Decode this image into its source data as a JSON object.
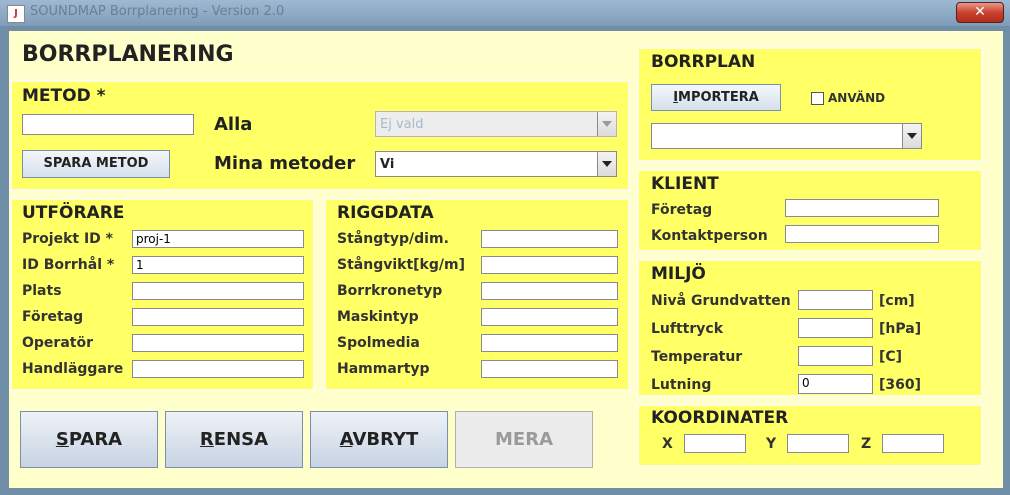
{
  "window": {
    "title": "SOUNDMAP Borrplanering - Version 2.0",
    "close_label": "✕",
    "app_icon_label": "J"
  },
  "header": {
    "title": "BORRPLANERING"
  },
  "metod": {
    "title": "METOD *",
    "input_value": "",
    "alla_label": "Alla",
    "alla_selected": "Ej vald",
    "save_method_label": "SPARA METOD",
    "mina_label": "Mina metoder",
    "mina_selected": "Vi"
  },
  "utforare": {
    "title": "UTFÖRARE",
    "fields": [
      {
        "label": "Projekt ID *",
        "value": "proj-1"
      },
      {
        "label": "ID Borrhål *",
        "value": "1"
      },
      {
        "label": "Plats",
        "value": ""
      },
      {
        "label": "Företag",
        "value": ""
      },
      {
        "label": "Operatör",
        "value": ""
      },
      {
        "label": "Handläggare",
        "value": ""
      }
    ]
  },
  "riggdata": {
    "title": "RIGGDATA",
    "fields": [
      {
        "label": "Stångtyp/dim.",
        "value": ""
      },
      {
        "label": "Stångvikt[kg/m]",
        "value": ""
      },
      {
        "label": "Borrkronetyp",
        "value": ""
      },
      {
        "label": "Maskintyp",
        "value": ""
      },
      {
        "label": "Spolmedia",
        "value": ""
      },
      {
        "label": "Hammartyp",
        "value": ""
      }
    ]
  },
  "buttons": {
    "spara_first": "S",
    "spara_rest": "PARA",
    "rensa_first": "R",
    "rensa_rest": "ENSA",
    "avbryt_first": "A",
    "avbryt_rest": "VBRYT",
    "mera": "MERA"
  },
  "borrplan": {
    "title": "BORRPLAN",
    "import_first": "I",
    "import_rest": "MPORTERA",
    "use_label": "ANVÄND",
    "use_checked": false,
    "selected": ""
  },
  "klient": {
    "title": "KLIENT",
    "fields": [
      {
        "label": "Företag",
        "value": ""
      },
      {
        "label": "Kontaktperson",
        "value": ""
      }
    ]
  },
  "miljo": {
    "title": "MILJÖ",
    "fields": [
      {
        "label": "Nivå Grundvatten",
        "value": "",
        "unit": "[cm]"
      },
      {
        "label": "Lufttryck",
        "value": "",
        "unit": "[hPa]"
      },
      {
        "label": "Temperatur",
        "value": "",
        "unit": "[C]"
      },
      {
        "label": "Lutning",
        "value": "0",
        "unit": "[360]"
      }
    ]
  },
  "koordinater": {
    "title": "KOORDINATER",
    "x_label": "X",
    "x_value": "",
    "y_label": "Y",
    "y_value": "",
    "z_label": "Z",
    "z_value": ""
  },
  "colors": {
    "panel": "#ffff66",
    "background": "#ffffcc",
    "close": "#c8412c"
  }
}
